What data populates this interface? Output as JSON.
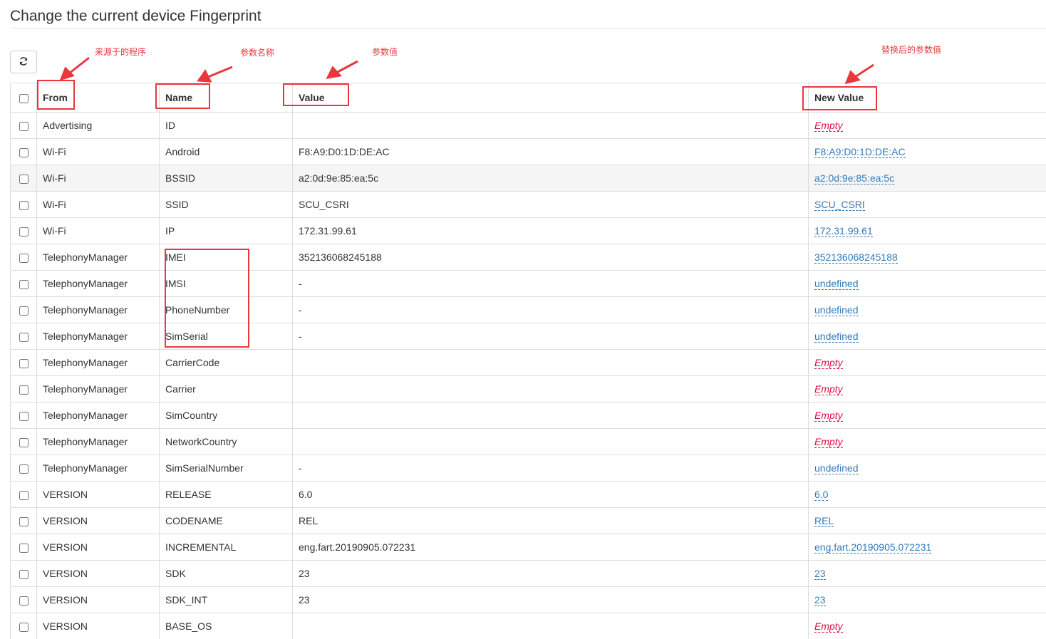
{
  "page": {
    "title": "Change the current device Fingerprint"
  },
  "toolbar": {
    "refresh_icon": "refresh-icon"
  },
  "table": {
    "headers": {
      "from": "From",
      "name": "Name",
      "value": "Value",
      "new_value": "New Value"
    },
    "rows": [
      {
        "from": "Advertising",
        "name": "ID",
        "value": "",
        "new_value": "Empty",
        "empty": true
      },
      {
        "from": "Wi-Fi",
        "name": "Android",
        "value": "F8:A9:D0:1D:DE:AC",
        "new_value": "F8:A9:D0:1D:DE:AC",
        "empty": false
      },
      {
        "from": "Wi-Fi",
        "name": "BSSID",
        "value": "a2:0d:9e:85:ea:5c",
        "new_value": "a2:0d:9e:85:ea:5c",
        "empty": false
      },
      {
        "from": "Wi-Fi",
        "name": "SSID",
        "value": "SCU_CSRI",
        "new_value": "SCU_CSRI",
        "empty": false
      },
      {
        "from": "Wi-Fi",
        "name": "IP",
        "value": "172.31.99.61",
        "new_value": "172.31.99.61",
        "empty": false
      },
      {
        "from": "TelephonyManager",
        "name": "IMEI",
        "value": "352136068245188",
        "new_value": "352136068245188",
        "empty": false
      },
      {
        "from": "TelephonyManager",
        "name": "IMSI",
        "value": "-",
        "new_value": "undefined",
        "empty": false
      },
      {
        "from": "TelephonyManager",
        "name": "PhoneNumber",
        "value": "-",
        "new_value": "undefined",
        "empty": false
      },
      {
        "from": "TelephonyManager",
        "name": "SimSerial",
        "value": "-",
        "new_value": "undefined",
        "empty": false
      },
      {
        "from": "TelephonyManager",
        "name": "CarrierCode",
        "value": "",
        "new_value": "Empty",
        "empty": true
      },
      {
        "from": "TelephonyManager",
        "name": "Carrier",
        "value": "",
        "new_value": "Empty",
        "empty": true
      },
      {
        "from": "TelephonyManager",
        "name": "SimCountry",
        "value": "",
        "new_value": "Empty",
        "empty": true
      },
      {
        "from": "TelephonyManager",
        "name": "NetworkCountry",
        "value": "",
        "new_value": "Empty",
        "empty": true
      },
      {
        "from": "TelephonyManager",
        "name": "SimSerialNumber",
        "value": "-",
        "new_value": "undefined",
        "empty": false
      },
      {
        "from": "VERSION",
        "name": "RELEASE",
        "value": "6.0",
        "new_value": "6.0",
        "empty": false
      },
      {
        "from": "VERSION",
        "name": "CODENAME",
        "value": "REL",
        "new_value": "REL",
        "empty": false
      },
      {
        "from": "VERSION",
        "name": "INCREMENTAL",
        "value": "eng.fart.20190905.072231",
        "new_value": "eng.fart.20190905.072231",
        "empty": false
      },
      {
        "from": "VERSION",
        "name": "SDK",
        "value": "23",
        "new_value": "23",
        "empty": false
      },
      {
        "from": "VERSION",
        "name": "SDK_INT",
        "value": "23",
        "new_value": "23",
        "empty": false
      },
      {
        "from": "VERSION",
        "name": "BASE_OS",
        "value": "",
        "new_value": "Empty",
        "empty": true
      }
    ]
  },
  "annotations": {
    "from_note": "来源于的程序",
    "name_note": "参数名称",
    "value_note": "参数值",
    "new_value_note": "替换后的参数值"
  },
  "colors": {
    "annotation": "#e8383d",
    "link": "#337ab7",
    "empty": "#dd1144",
    "highlight_row": "#f5f5f5"
  }
}
